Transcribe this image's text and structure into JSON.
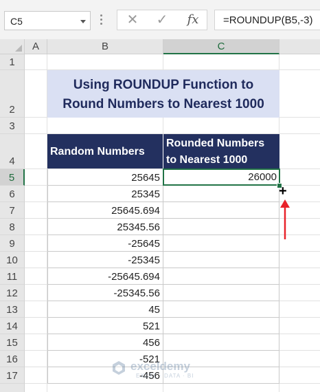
{
  "formula_bar": {
    "name_box": "C5",
    "cancel_symbol": "✕",
    "enter_symbol": "✓",
    "fx_symbol": "fx",
    "formula": "=ROUNDUP(B5,-3)"
  },
  "columns": [
    "A",
    "B",
    "C"
  ],
  "selected_column": "C",
  "rows": [
    "1",
    "2",
    "3",
    "4",
    "5",
    "6",
    "7",
    "8",
    "9",
    "10",
    "11",
    "12",
    "13",
    "14",
    "15",
    "16",
    "17"
  ],
  "selected_row": "5",
  "title": {
    "line1": "Using ROUNDUP Function to",
    "line2": "Round Numbers to Nearest 1000"
  },
  "table": {
    "header_b": "Random Numbers",
    "header_c_line1": "Rounded Numbers",
    "header_c_line2": "to Nearest 1000",
    "random_numbers": [
      "25645",
      "25345",
      "25645.694",
      "25345.56",
      "-25645",
      "-25345",
      "-25645.694",
      "-25345.56",
      "45",
      "521",
      "456",
      "-521",
      "-456"
    ],
    "rounded_numbers": [
      "26000",
      "",
      "",
      "",
      "",
      "",
      "",
      "",
      "",
      "",
      "",
      "",
      ""
    ]
  },
  "annotation": {
    "fill_handle_cursor": "+",
    "arrow_color": "#e8222a"
  },
  "watermark": {
    "name": "exceldemy",
    "tagline": "EXCEL · DATA · BI"
  },
  "colors": {
    "header_bg": "#23305f",
    "title_bg": "#dae0f3",
    "title_text": "#1f2a5c",
    "selection": "#217346"
  }
}
